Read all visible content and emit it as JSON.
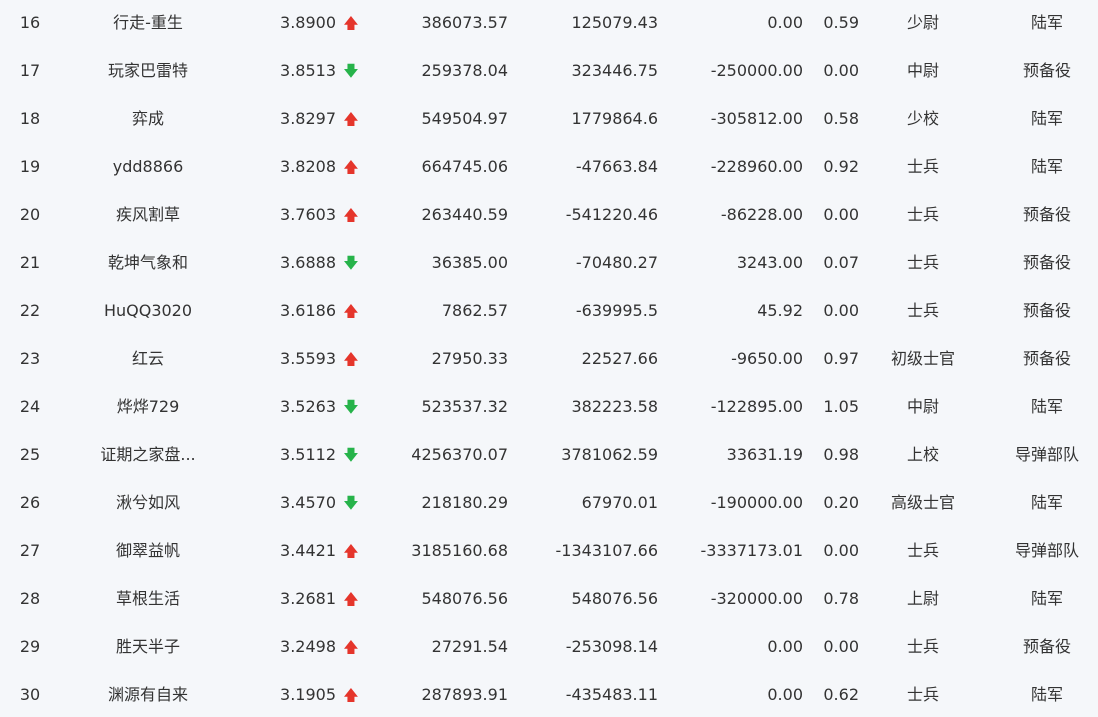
{
  "colors": {
    "background": "#f5f7fa",
    "text": "#333333",
    "up_arrow": "#e5352b",
    "down_arrow": "#26b34a"
  },
  "rows": [
    {
      "rank": "16",
      "name": "行走-重生",
      "score": "3.8900",
      "trend": "up",
      "arrow": "🡅",
      "v1": "386073.57",
      "v2": "125079.43",
      "v3": "0.00",
      "v4": "0.59",
      "military_rank": "少尉",
      "branch": "陆军"
    },
    {
      "rank": "17",
      "name": "玩家巴雷特",
      "score": "3.8513",
      "trend": "down",
      "arrow": "🡇",
      "v1": "259378.04",
      "v2": "323446.75",
      "v3": "-250000.00",
      "v4": "0.00",
      "military_rank": "中尉",
      "branch": "预备役"
    },
    {
      "rank": "18",
      "name": "弈成",
      "score": "3.8297",
      "trend": "up",
      "arrow": "🡅",
      "v1": "549504.97",
      "v2": "1779864.6",
      "v3": "-305812.00",
      "v4": "0.58",
      "military_rank": "少校",
      "branch": "陆军"
    },
    {
      "rank": "19",
      "name": "ydd8866",
      "score": "3.8208",
      "trend": "up",
      "arrow": "🡅",
      "v1": "664745.06",
      "v2": "-47663.84",
      "v3": "-228960.00",
      "v4": "0.92",
      "military_rank": "士兵",
      "branch": "陆军"
    },
    {
      "rank": "20",
      "name": "疾风割草",
      "score": "3.7603",
      "trend": "up",
      "arrow": "🡅",
      "v1": "263440.59",
      "v2": "-541220.46",
      "v3": "-86228.00",
      "v4": "0.00",
      "military_rank": "士兵",
      "branch": "预备役"
    },
    {
      "rank": "21",
      "name": "乾坤气象和",
      "score": "3.6888",
      "trend": "down",
      "arrow": "🡇",
      "v1": "36385.00",
      "v2": "-70480.27",
      "v3": "3243.00",
      "v4": "0.07",
      "military_rank": "士兵",
      "branch": "预备役"
    },
    {
      "rank": "22",
      "name": "HuQQ3020",
      "score": "3.6186",
      "trend": "up",
      "arrow": "🡅",
      "v1": "7862.57",
      "v2": "-639995.5",
      "v3": "45.92",
      "v4": "0.00",
      "military_rank": "士兵",
      "branch": "预备役"
    },
    {
      "rank": "23",
      "name": "红云",
      "score": "3.5593",
      "trend": "up",
      "arrow": "🡅",
      "v1": "27950.33",
      "v2": "22527.66",
      "v3": "-9650.00",
      "v4": "0.97",
      "military_rank": "初级士官",
      "branch": "预备役"
    },
    {
      "rank": "24",
      "name": "烨烨729",
      "score": "3.5263",
      "trend": "down",
      "arrow": "🡇",
      "v1": "523537.32",
      "v2": "382223.58",
      "v3": "-122895.00",
      "v4": "1.05",
      "military_rank": "中尉",
      "branch": "陆军"
    },
    {
      "rank": "25",
      "name": "证期之家盘...",
      "score": "3.5112",
      "trend": "down",
      "arrow": "🡇",
      "v1": "4256370.07",
      "v2": "3781062.59",
      "v3": "33631.19",
      "v4": "0.98",
      "military_rank": "上校",
      "branch": "导弹部队"
    },
    {
      "rank": "26",
      "name": "湫兮如风",
      "score": "3.4570",
      "trend": "down",
      "arrow": "🡇",
      "v1": "218180.29",
      "v2": "67970.01",
      "v3": "-190000.00",
      "v4": "0.20",
      "military_rank": "高级士官",
      "branch": "陆军"
    },
    {
      "rank": "27",
      "name": "御翠益帆",
      "score": "3.4421",
      "trend": "up",
      "arrow": "🡅",
      "v1": "3185160.68",
      "v2": "-1343107.66",
      "v3": "-3337173.01",
      "v4": "0.00",
      "military_rank": "士兵",
      "branch": "导弹部队"
    },
    {
      "rank": "28",
      "name": "草根生活",
      "score": "3.2681",
      "trend": "up",
      "arrow": "🡅",
      "v1": "548076.56",
      "v2": "548076.56",
      "v3": "-320000.00",
      "v4": "0.78",
      "military_rank": "上尉",
      "branch": "陆军"
    },
    {
      "rank": "29",
      "name": "胜天半子",
      "score": "3.2498",
      "trend": "up",
      "arrow": "🡅",
      "v1": "27291.54",
      "v2": "-253098.14",
      "v3": "0.00",
      "v4": "0.00",
      "military_rank": "士兵",
      "branch": "预备役"
    },
    {
      "rank": "30",
      "name": "渊源有自来",
      "score": "3.1905",
      "trend": "up",
      "arrow": "🡅",
      "v1": "287893.91",
      "v2": "-435483.11",
      "v3": "0.00",
      "v4": "0.62",
      "military_rank": "士兵",
      "branch": "陆军"
    }
  ]
}
